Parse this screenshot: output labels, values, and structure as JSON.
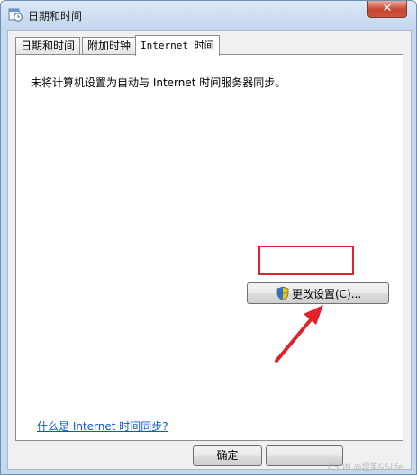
{
  "window": {
    "title": "日期和时间",
    "close_symbol": "✕",
    "icon": "clock-calendar-icon"
  },
  "tabs": [
    {
      "label": "日期和时间",
      "active": false
    },
    {
      "label": "附加时钟",
      "active": false
    },
    {
      "label": "Internet 时间",
      "active": true
    }
  ],
  "panel": {
    "status_text": "未将计算机设置为自动与 Internet 时间服务器同步。",
    "change_button_label": "更改设置(C)...",
    "help_link": "什么是 Internet 时间同步?"
  },
  "footer": {
    "ok_label": "确定",
    "cancel_label": ""
  },
  "annotation": {
    "highlight_color": "#e0232b"
  },
  "watermark": "CSDN @坦笑&&life"
}
